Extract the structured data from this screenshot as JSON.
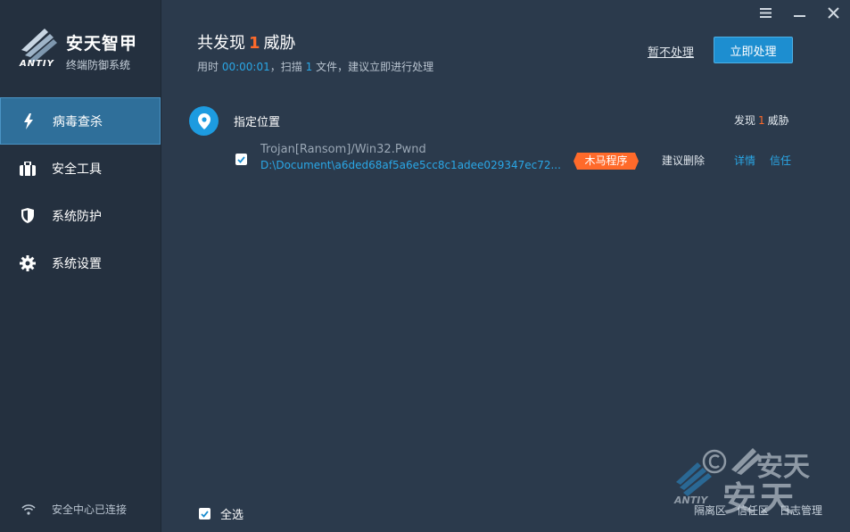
{
  "brand": {
    "name": "安天智甲",
    "subtitle": "终端防御系统",
    "logo_text": "ANTIY"
  },
  "sidebar": {
    "items": [
      {
        "label": "病毒查杀",
        "icon": "lightning-icon",
        "active": true
      },
      {
        "label": "安全工具",
        "icon": "toolbox-icon",
        "active": false
      },
      {
        "label": "系统防护",
        "icon": "shield-icon",
        "active": false
      },
      {
        "label": "系统设置",
        "icon": "gear-icon",
        "active": false
      }
    ],
    "connection_status": "安全中心已连接"
  },
  "header": {
    "title_prefix": "共发现",
    "threat_count": "1",
    "title_suffix": "威胁",
    "time_label": "用时",
    "time_value": "00:00:01",
    "scan_label": "，扫描",
    "scan_count": "1",
    "scan_suffix": "文件，建议立即进行处理",
    "ignore_label": "暂不处理",
    "handle_label": "立即处理"
  },
  "group": {
    "title": "指定位置",
    "count_prefix": "发现",
    "count": "1",
    "count_suffix": "威胁"
  },
  "threats": [
    {
      "name": "Trojan[Ransom]/Win32.Pwnd",
      "path": "D:\\Document\\a6ded68af5a6e5cc8c1adee029347ec72...",
      "category": "木马程序",
      "suggestion": "建议删除",
      "detail_label": "详情",
      "trust_label": "信任",
      "checked": true
    }
  ],
  "footer": {
    "select_all_label": "全选",
    "links": [
      "隔离区",
      "信任区",
      "日志管理"
    ]
  },
  "watermark": {
    "text": "安天",
    "logo_text": "ANTIY"
  },
  "colors": {
    "accent": "#1d8ed0",
    "threat": "#ff6a2a",
    "link": "#2aa7e6",
    "sidebar_bg": "#24303f",
    "main_bg": "#2b3a4c"
  }
}
